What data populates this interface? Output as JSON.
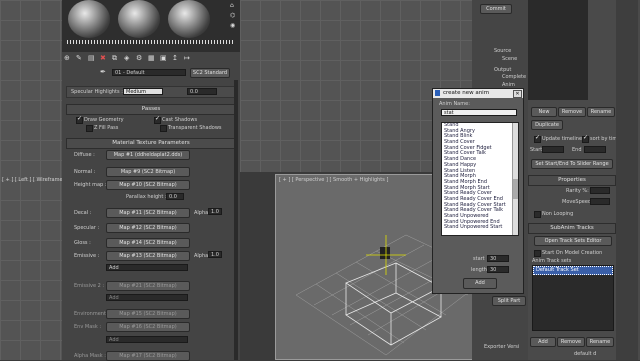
{
  "viewport_left_label": "[ + ] [ Left ] [ Wireframe ]",
  "viewport_persp_label": "[ + ] [ Perspective ] [ Smooth + Highlights ]",
  "material_editor": {
    "material_name": "01 - Default",
    "material_type": "SC2 Standard",
    "specular_highlights_label": "Specular Highlights :",
    "specular_highlights_value": "Medium",
    "specular_value": "0.0",
    "passes_title": "Passes",
    "draw_geometry": "Draw Geometry",
    "cast_shadows": "Cast Shadows",
    "z_fill_pass": "Z Fill Pass",
    "transparent_shadows": "Transparent Shadows",
    "texture_params_title": "Material Texture Parameters",
    "maps": [
      {
        "label": "Diffuse :",
        "value": "Map #1 (ddheldaplat2.dds)"
      },
      {
        "label": "Normal :",
        "value": "Map #9 (SC2 Bitmap)"
      },
      {
        "label": "Height map :",
        "value": "Map #10 (SC2 Bitmap)"
      },
      {
        "label": "Decal :",
        "value": "Map #11 (SC2 Bitmap)"
      },
      {
        "label": "Specular :",
        "value": "Map #12 (SC2 Bitmap)"
      },
      {
        "label": "Gloss :",
        "value": "Map #14 (SC2 Bitmap)"
      },
      {
        "label": "Emissive :",
        "value": "Map #13 (SC2 Bitmap)"
      },
      {
        "label": "Emissive 2 :",
        "value": "Map #21 (SC2 Bitmap)"
      },
      {
        "label": "Environment :",
        "value": "Map #15 (SC2 Bitmap)"
      },
      {
        "label": "Env Mask :",
        "value": "Map #16 (SC2 Bitmap)"
      },
      {
        "label": "Alpha Mask :",
        "value": "Map #17 (SC2 Bitmap)"
      }
    ],
    "parallax_label": "Parallax height :",
    "parallax_value": "0.0",
    "alpha_label": "Alpha",
    "alpha_value": "1.0",
    "add_label": "Add"
  },
  "commit_label": "Commit",
  "source_label": "Source",
  "scene_label": "Scene",
  "output_label": "Output",
  "complete_label": "Complete",
  "anim_label": "Anim",
  "anim_tracks": {
    "new": "New",
    "remove": "Remove",
    "rename": "Rename",
    "duplicate": "Duplicate",
    "update_timeline": "Update timeline",
    "sort_by_time": "sort by time",
    "start_label": "Start",
    "end_label": "End",
    "set_start_end": "Set Start/End To Slider Range",
    "properties_title": "Properties",
    "rarity_label": "Rarity %:",
    "move_speed_label": "MoveSpeed",
    "non_looping": "Non Looping",
    "subanim_title": "SubAnim Tracks",
    "open_track_sets": "Open Track Sets Editor",
    "start_on_model": "Start On Model Creation",
    "anim_track_sets": "Anim Track sets",
    "default_track_set": "Default Track Set",
    "add": "Add",
    "remove2": "Remove",
    "rename2": "Rename",
    "default_d": "default d"
  },
  "dialog": {
    "title": "create new anim",
    "anim_name_label": "Anim Name:",
    "anim_name_value": "stat",
    "items": [
      "Stand",
      "Stand Angry",
      "Stand Blink",
      "Stand Cover",
      "Stand Cover Fidget",
      "Stand Cover Talk",
      "Stand Dance",
      "Stand Happy",
      "Stand Listen",
      "Stand Morph",
      "Stand Morph End",
      "Stand Morph Start",
      "Stand Ready Cover",
      "Stand Ready Cover End",
      "Stand Ready Cover Start",
      "Stand Ready Cover Talk",
      "Stand Unpowered",
      "Stand Unpowered End",
      "Stand Unpowered Start"
    ],
    "start_label": "start",
    "start_value": "30",
    "length_label": "length",
    "length_value": "30",
    "add_label": "Add"
  },
  "split_part_label": "Split Part",
  "exporter_label": "Exporter Versi"
}
